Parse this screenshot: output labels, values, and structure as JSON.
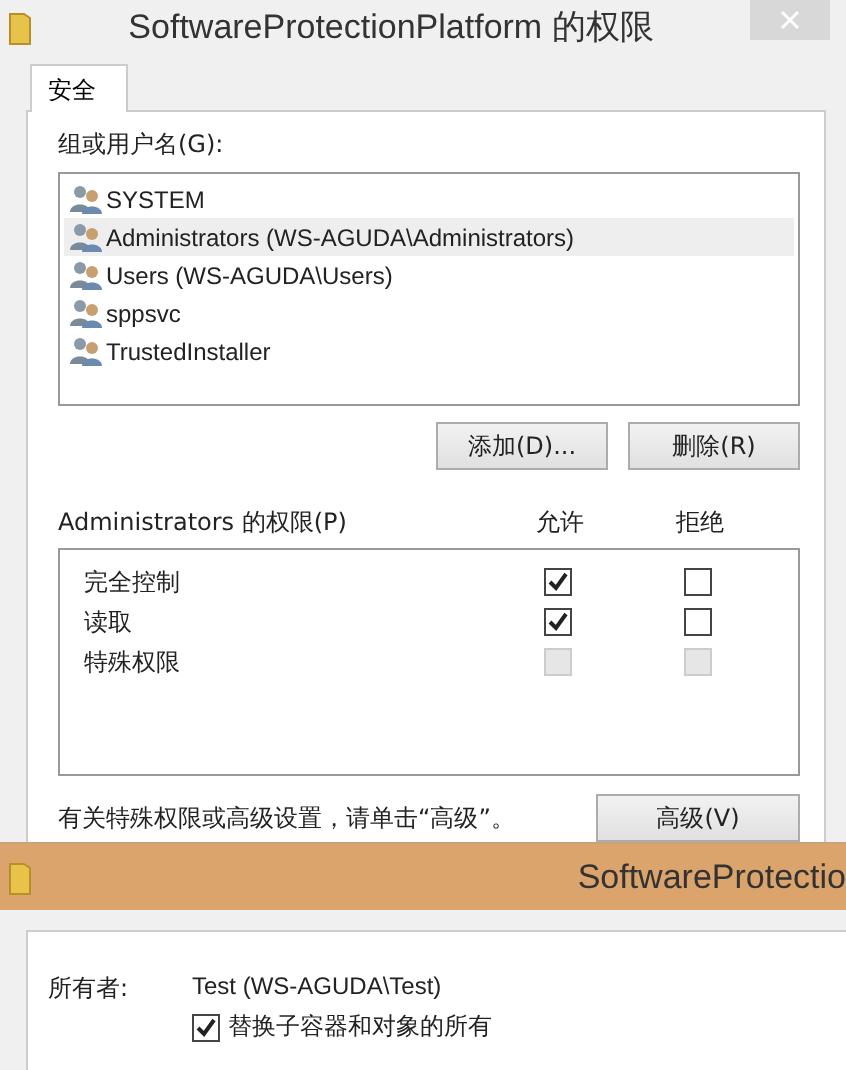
{
  "window": {
    "title": "SoftwareProtectionPlatform 的权限"
  },
  "tabs": [
    {
      "label": "安全",
      "selected": true
    }
  ],
  "groups": {
    "label": "组或用户名(G):",
    "items": [
      {
        "name": "SYSTEM",
        "selected": false
      },
      {
        "name": "Administrators (WS-AGUDA\\Administrators)",
        "selected": true
      },
      {
        "name": "Users (WS-AGUDA\\Users)",
        "selected": false
      },
      {
        "name": "sppsvc",
        "selected": false
      },
      {
        "name": "TrustedInstaller",
        "selected": false
      }
    ]
  },
  "group_buttons": [
    "添加(D)...",
    "删除(R)"
  ],
  "permissions": {
    "label": "Administrators 的权限(P)",
    "allow_heading": "允许",
    "deny_heading": "拒绝",
    "rows": [
      {
        "name": "完全控制",
        "allow": true,
        "deny": false,
        "disabled": false
      },
      {
        "name": "读取",
        "allow": true,
        "deny": false,
        "disabled": false
      },
      {
        "name": "特殊权限",
        "allow": false,
        "deny": false,
        "disabled": true
      }
    ]
  },
  "advanced_hint": "有关特殊权限或高级设置，请单击“高级”。",
  "advanced_button": "高级(V)",
  "second_window": {
    "title": "SoftwareProtectio",
    "owner_label": "所有者:",
    "owner_value": "Test (WS-AGUDA\\Test)",
    "replace_owner": {
      "label": "替换子容器和对象的所有",
      "checked": true
    }
  }
}
